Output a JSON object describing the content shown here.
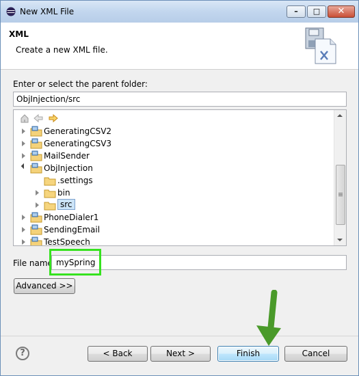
{
  "window": {
    "title": "New XML File",
    "close_glyph": "✕",
    "min_glyph": "–",
    "max_glyph": "□"
  },
  "header": {
    "title": "XML",
    "description": "Create a new XML file.",
    "icon": "xml-file-wizard-icon"
  },
  "parent": {
    "label": "Enter or select the parent folder:",
    "value": "ObjInjection/src"
  },
  "tree": {
    "toolbar": [
      "home-icon",
      "back-arrow-icon",
      "forward-arrow-icon"
    ],
    "items": [
      {
        "label": "GeneratingCSV2",
        "level": 0,
        "expanded": false,
        "type": "project"
      },
      {
        "label": "GeneratingCSV3",
        "level": 0,
        "expanded": false,
        "type": "project"
      },
      {
        "label": "MailSender",
        "level": 0,
        "expanded": false,
        "type": "project"
      },
      {
        "label": "ObjInjection",
        "level": 0,
        "expanded": true,
        "type": "project"
      },
      {
        "label": ".settings",
        "level": 1,
        "expanded": null,
        "type": "folder"
      },
      {
        "label": "bin",
        "level": 1,
        "expanded": false,
        "type": "folder"
      },
      {
        "label": "src",
        "level": 1,
        "expanded": false,
        "type": "folder",
        "selected": true
      },
      {
        "label": "PhoneDialer1",
        "level": 0,
        "expanded": false,
        "type": "project"
      },
      {
        "label": "SendingEmail",
        "level": 0,
        "expanded": false,
        "type": "project"
      },
      {
        "label": "TestSpeech",
        "level": 0,
        "expanded": false,
        "type": "project"
      }
    ]
  },
  "file": {
    "label": "File name:",
    "value": "mySpring"
  },
  "buttons": {
    "advanced": "Advanced >>",
    "back": "< Back",
    "next": "Next >",
    "finish": "Finish",
    "cancel": "Cancel",
    "help": "?"
  },
  "colors": {
    "highlight": "#36e21f",
    "arrow": "#4a9a2a",
    "selection": "#cce4f7"
  }
}
